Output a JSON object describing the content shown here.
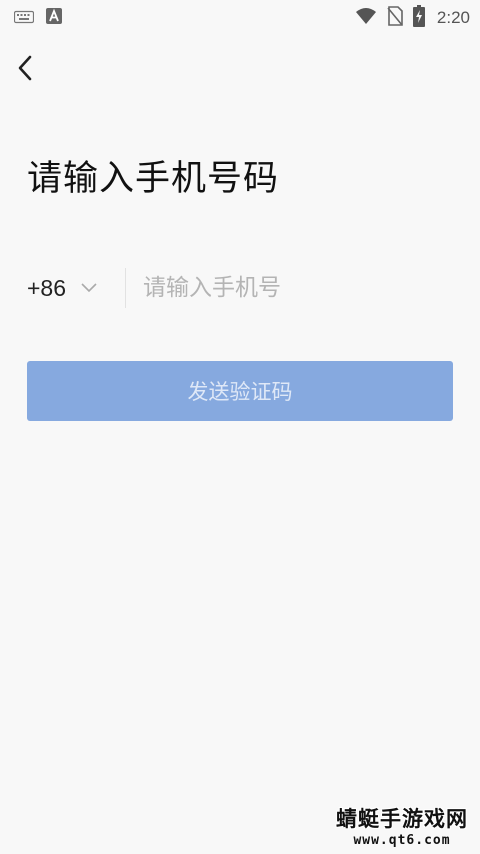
{
  "status_bar": {
    "time": "2:20",
    "left_icons": [
      "keyboard-icon",
      "app-a-icon"
    ],
    "right_icons": [
      "wifi-icon",
      "no-sim-icon",
      "battery-charging-icon"
    ]
  },
  "header": {
    "back_icon": "chevron-left-icon"
  },
  "page": {
    "title": "请输入手机号码"
  },
  "phone_form": {
    "country_code": "+86",
    "country_dropdown_icon": "chevron-down-icon",
    "phone_placeholder": "请输入手机号",
    "phone_value": ""
  },
  "actions": {
    "send_code_label": "发送验证码"
  },
  "watermark": {
    "line1": "蜻蜓手游戏网",
    "line2": "www.qt6.com"
  },
  "colors": {
    "background": "#f8f8f8",
    "button_disabled": "#86a9df",
    "button_text": "#dfe8f7",
    "placeholder": "#b4b4b4"
  }
}
